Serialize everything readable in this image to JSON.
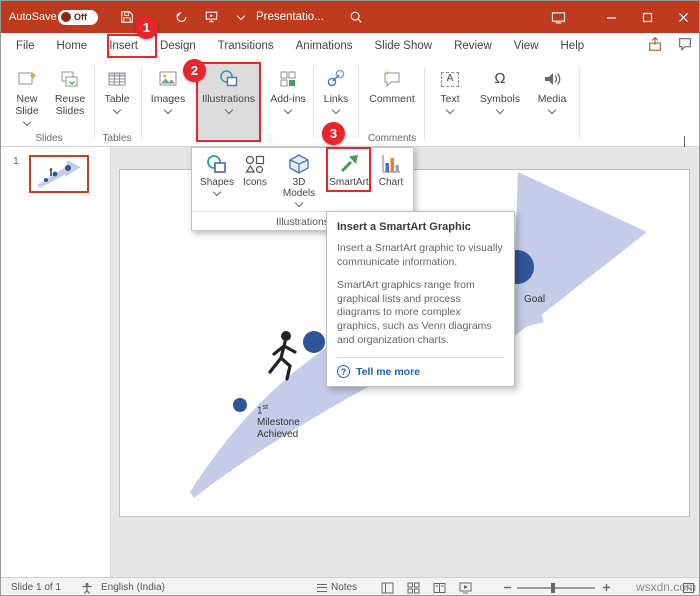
{
  "icons": {
    "omega": "Ω",
    "text_glyph": "A",
    "question": "?"
  },
  "titlebar": {
    "autosave_label": "AutoSave",
    "autosave_state": "Off",
    "title": "Presentatio..."
  },
  "menubar": {
    "items": [
      "File",
      "Home",
      "Insert",
      "Design",
      "Transitions",
      "Animations",
      "Slide Show",
      "Review",
      "View",
      "Help"
    ]
  },
  "ribbon": {
    "buttons": [
      {
        "label": "New Slide"
      },
      {
        "label": "Reuse Slides"
      },
      {
        "label": "Table"
      },
      {
        "label": "Images"
      },
      {
        "label": "Illustrations"
      },
      {
        "label": "Add-ins"
      },
      {
        "label": "Links"
      },
      {
        "label": "Comment"
      },
      {
        "label": "Text"
      },
      {
        "label": "Symbols"
      },
      {
        "label": "Media"
      }
    ],
    "group_labels": {
      "slides": "Slides",
      "tables": "Tables",
      "comments": "Comments"
    }
  },
  "annotations": {
    "step1": "1",
    "step2": "2",
    "step3": "3"
  },
  "illustrations_menu": {
    "items": [
      {
        "label": "Shapes"
      },
      {
        "label": "Icons"
      },
      {
        "label": "3D Models"
      },
      {
        "label": "SmartArt"
      },
      {
        "label": "Chart"
      }
    ],
    "footer": "Illustrations"
  },
  "tooltip": {
    "title": "Insert a SmartArt Graphic",
    "p1": "Insert a SmartArt graphic to visually communicate information.",
    "p2": "SmartArt graphics range from graphical lists and process diagrams to more complex graphics, such as Venn diagrams and organization charts.",
    "link": "Tell me more"
  },
  "slide_panel": {
    "number": "1"
  },
  "slide": {
    "goal": "Goal",
    "milestone_num": "1",
    "milestone_sup": "st",
    "milestone_word1": "Milestone",
    "milestone_word2": "Achieved"
  },
  "statusbar": {
    "slide_indicator": "Slide 1 of 1",
    "language": "English (India)",
    "notes": "Notes"
  },
  "watermark": "wsxdn.com"
}
